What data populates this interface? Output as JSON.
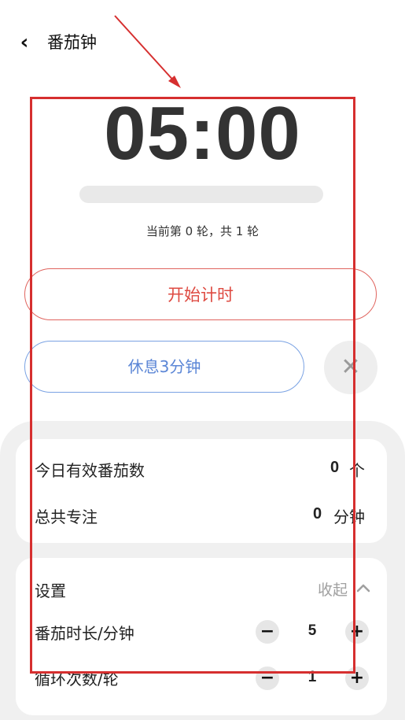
{
  "header": {
    "back_icon": "chevron-left-icon",
    "title": "番茄钟"
  },
  "timer": {
    "display": "05:00",
    "progress_fraction": 0,
    "round_info": "当前第 0 轮，共 1 轮"
  },
  "actions": {
    "start_label": "开始计时",
    "rest_label": "休息3分钟",
    "close_icon": "close-icon"
  },
  "stats": {
    "today_label": "今日有效番茄数",
    "today_value": "0",
    "today_unit": "个",
    "total_label": "总共专注",
    "total_value": "0",
    "total_unit": "分钟"
  },
  "settings": {
    "title": "设置",
    "collapse_label": "收起",
    "collapse_icon": "chevron-up-icon",
    "duration_label": "番茄时长/分钟",
    "duration_value": "5",
    "cycles_label": "循环次数/轮",
    "cycles_value": "1",
    "minus_glyph": "−",
    "plus_glyph": "+"
  },
  "colors": {
    "accent_red": "#de4a41",
    "accent_blue": "#5b86d6",
    "annotation_red": "#d62f2f"
  }
}
